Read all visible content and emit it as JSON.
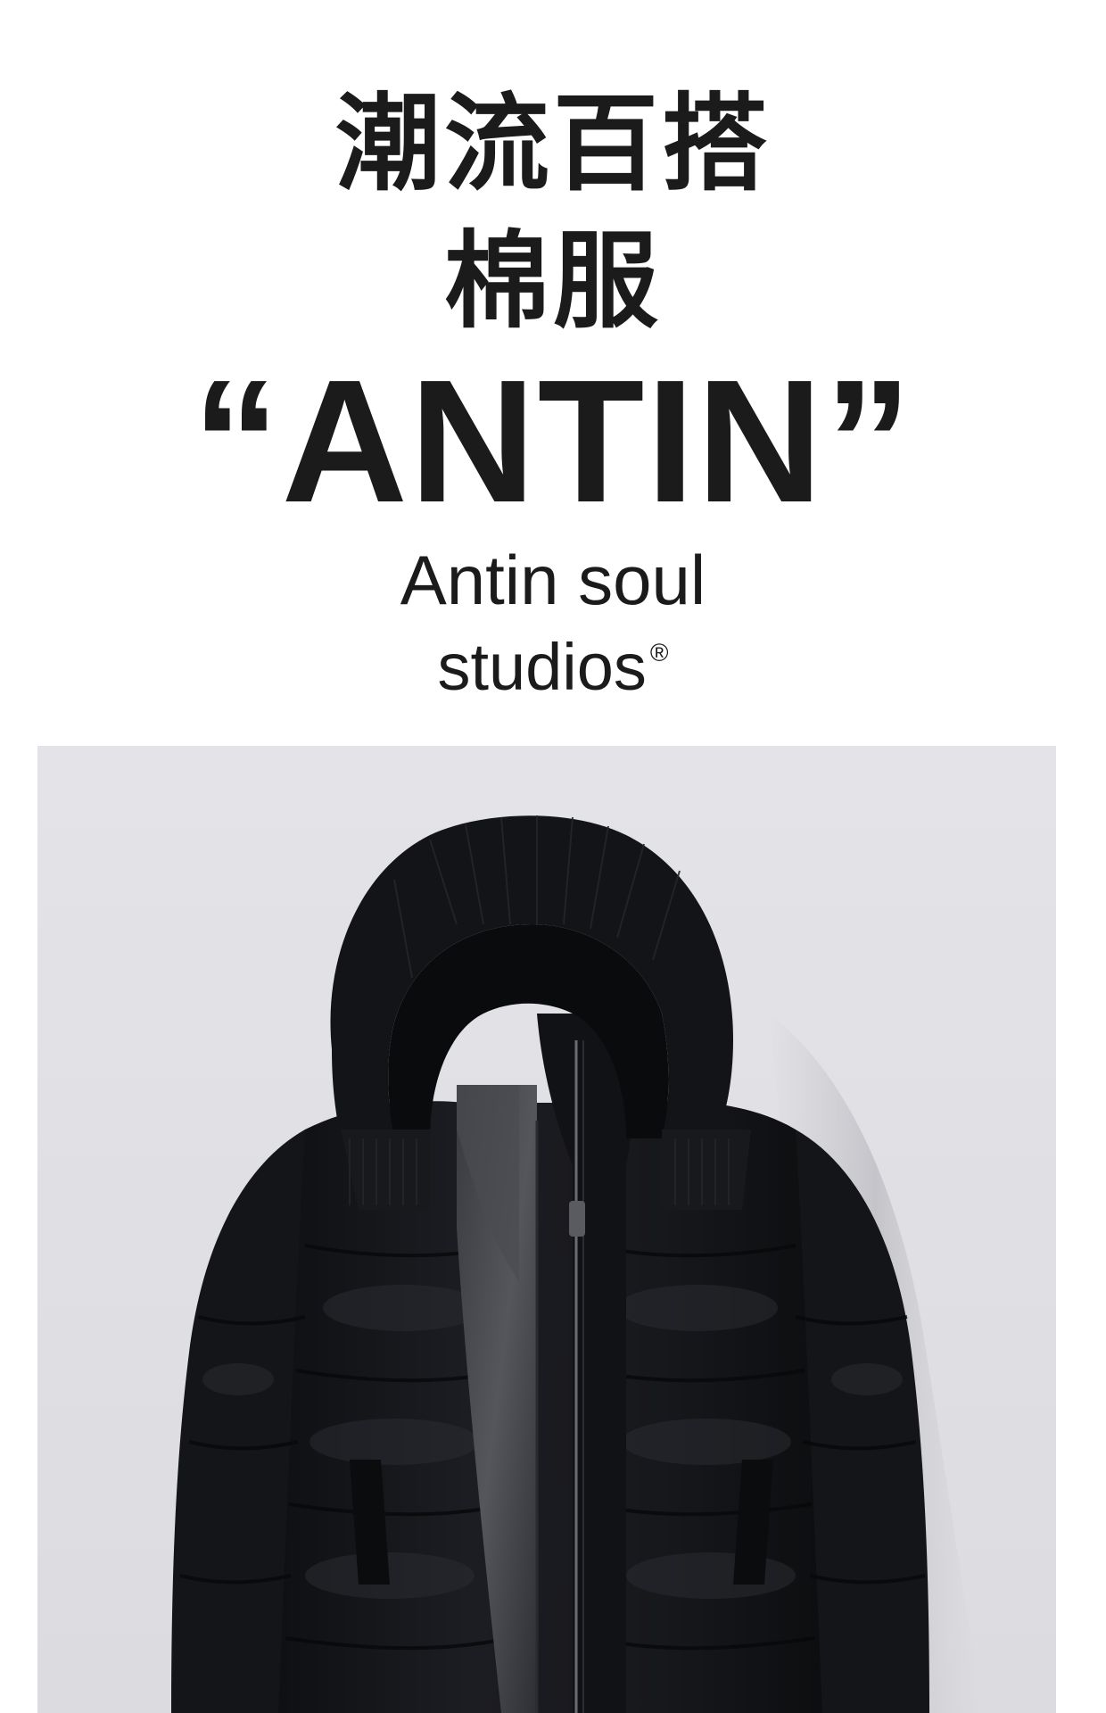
{
  "headline": {
    "line1": "潮流百搭",
    "line2": "棉服"
  },
  "brand": {
    "name": "“ANTIN”"
  },
  "subtitle": {
    "line1": "Antin soul",
    "line2": "studios",
    "registered_mark": "®"
  },
  "product_photo": {
    "subject": "black-hooded-puffer-jacket",
    "background_color": "#e2e2e6",
    "garment_color": "#16171a"
  }
}
